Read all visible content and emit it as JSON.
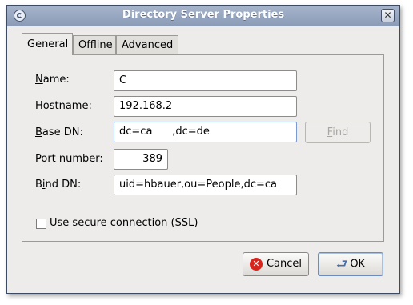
{
  "window": {
    "title": "Directory Server Properties",
    "close_symbol": "✕"
  },
  "tabs": [
    {
      "label": "General"
    },
    {
      "label": "Offline"
    },
    {
      "label": "Advanced"
    }
  ],
  "form": {
    "name": {
      "label_mnemonic": "N",
      "label_rest": "ame:",
      "value": "C"
    },
    "hostname": {
      "label_mnemonic": "H",
      "label_rest": "ostname:",
      "value": "192.168.2"
    },
    "base_dn": {
      "label_mnemonic": "B",
      "label_rest": "ase DN:",
      "value": "dc=ca      ,dc=de"
    },
    "port": {
      "label": "Port number:",
      "value": "389"
    },
    "bind_dn": {
      "label_pre": "B",
      "label_mnemonic": "i",
      "label_rest": "nd DN:",
      "value": "uid=hbauer,ou=People,dc=ca"
    },
    "find_button": {
      "label_mnemonic": "F",
      "label_rest": "ind"
    },
    "ssl": {
      "label_mnemonic": "U",
      "label_rest": "se secure connection (SSL)",
      "checked": false
    }
  },
  "buttons": {
    "cancel": "Cancel",
    "ok": "OK"
  }
}
